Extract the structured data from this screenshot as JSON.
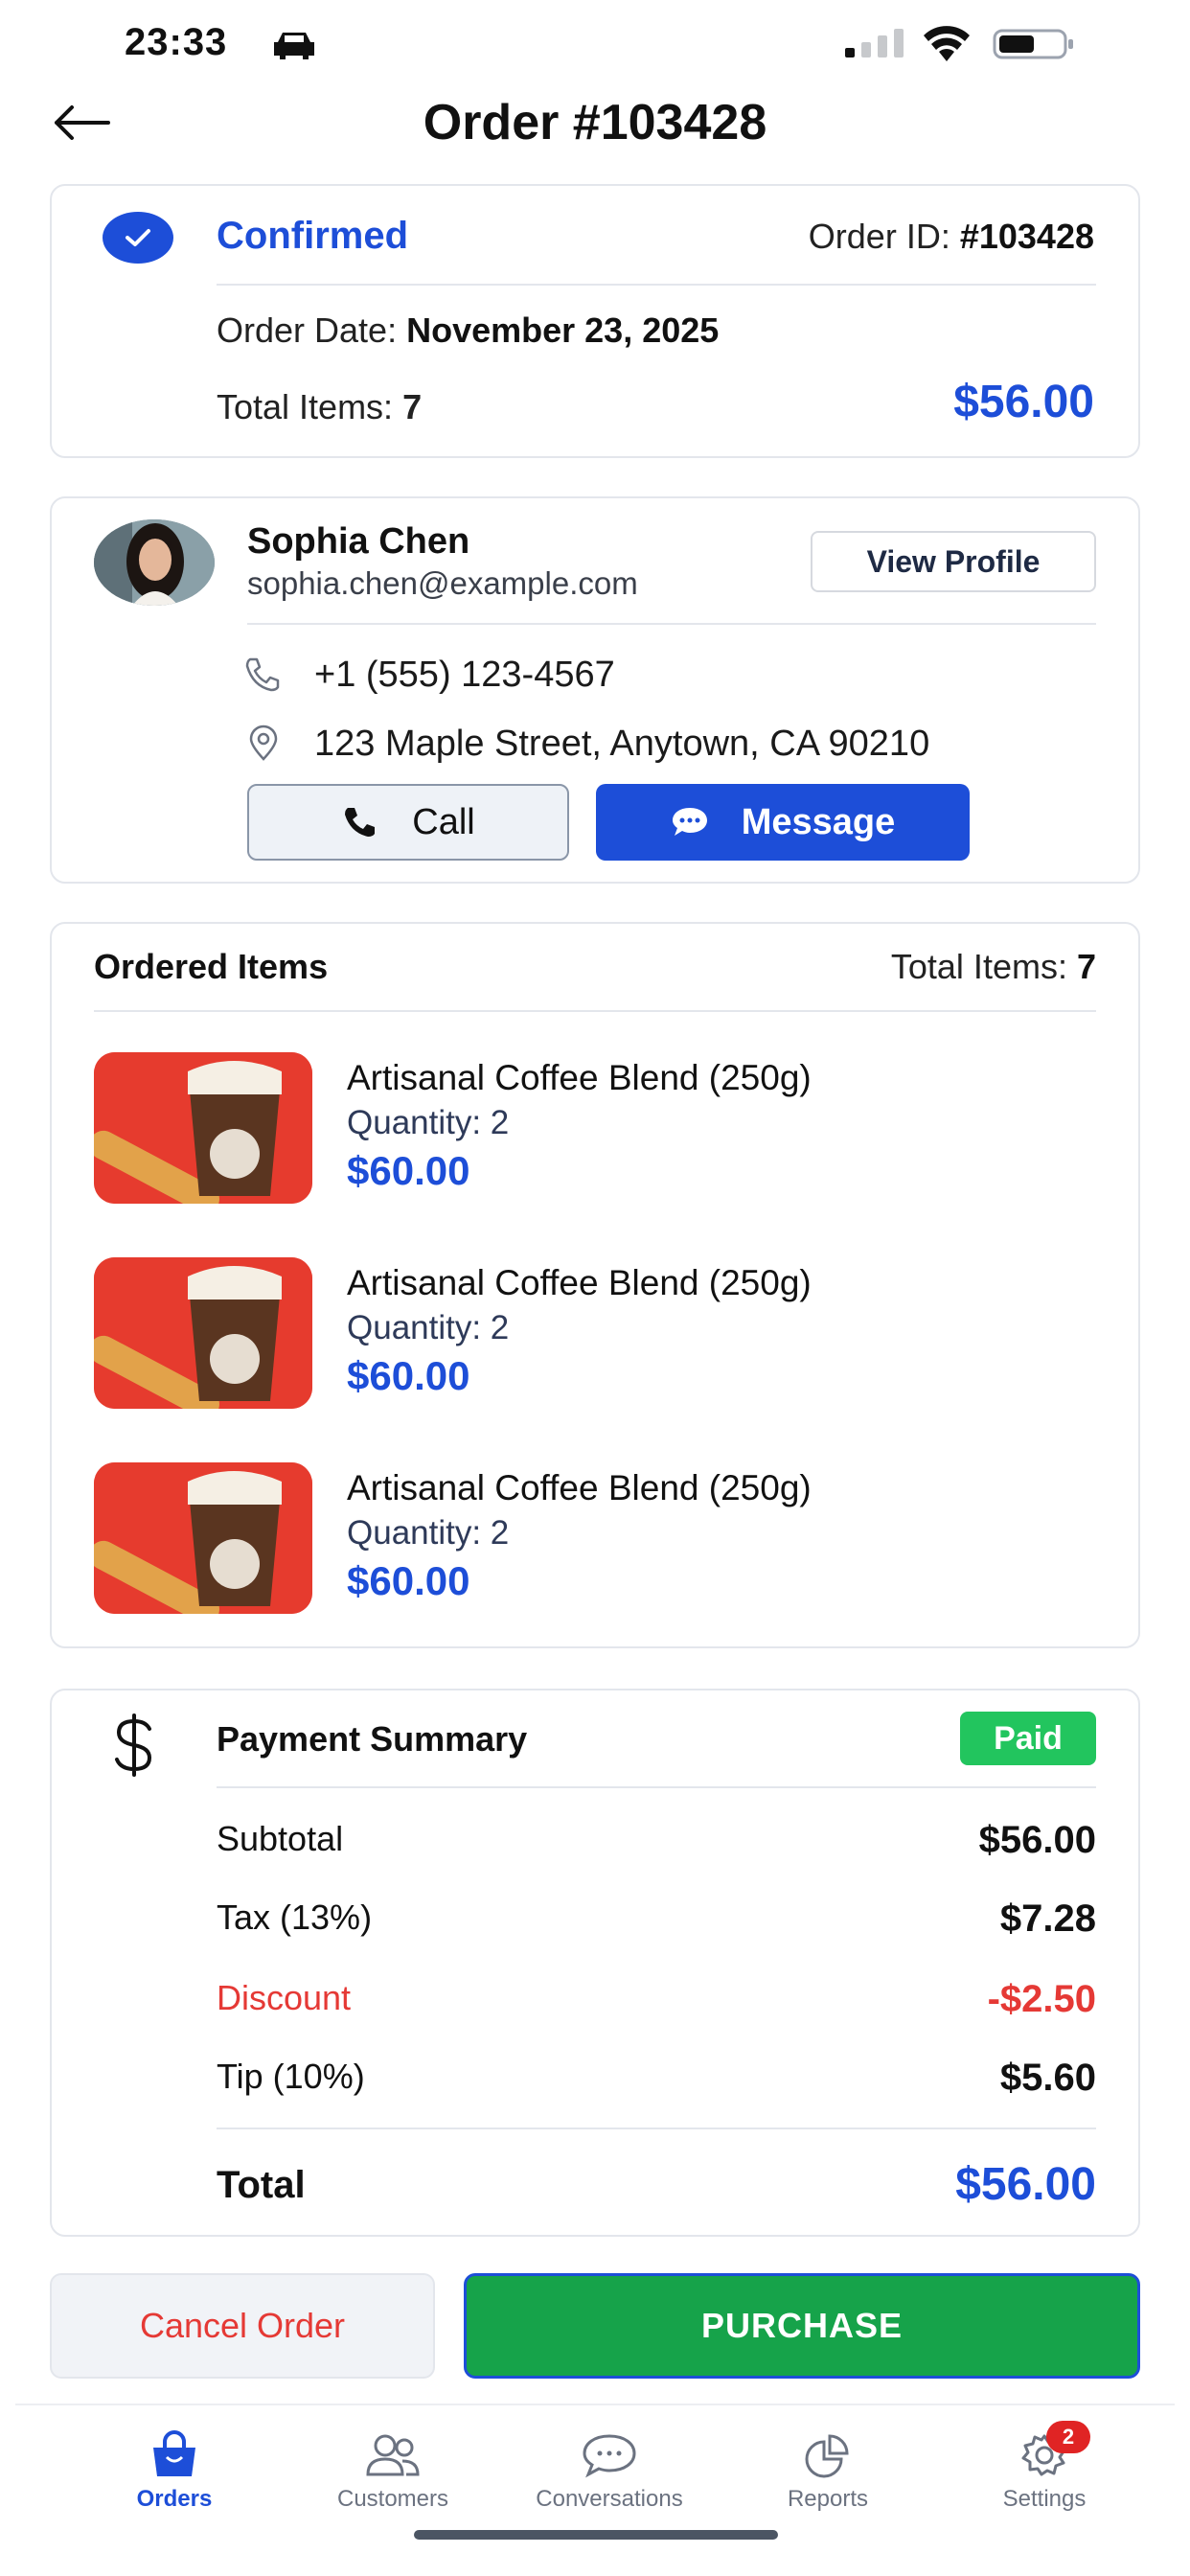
{
  "status_bar": {
    "time": "23:33"
  },
  "nav": {
    "title": "Order #103428"
  },
  "order": {
    "status": "Confirmed",
    "id_label": "Order ID:",
    "id_value": "#103428",
    "date_label": "Order Date:",
    "date_value": "November 23, 2025",
    "items_label": "Total Items:",
    "items_value": "7",
    "total": "$56.00"
  },
  "customer": {
    "name": "Sophia Chen",
    "email": "sophia.chen@example.com",
    "view_profile_label": "View Profile",
    "phone": "+1 (555) 123-4567",
    "address": "123 Maple Street, Anytown, CA 90210",
    "call_label": "Call",
    "message_label": "Message"
  },
  "items_section": {
    "title": "Ordered Items",
    "total_label": "Total Items:",
    "total_value": "7",
    "items": [
      {
        "name": "Artisanal Coffee Blend (250g)",
        "quantity": "Quantity: 2",
        "price": "$60.00"
      },
      {
        "name": "Artisanal Coffee Blend (250g)",
        "quantity": "Quantity: 2",
        "price": "$60.00"
      },
      {
        "name": "Artisanal Coffee Blend (250g)",
        "quantity": "Quantity: 2",
        "price": "$60.00"
      }
    ]
  },
  "payment": {
    "title": "Payment Summary",
    "badge": "Paid",
    "subtotal_label": "Subtotal",
    "subtotal_value": "$56.00",
    "tax_label": "Tax (13%)",
    "tax_value": "$7.28",
    "discount_label": "Discount",
    "discount_value": "-$2.50",
    "tip_label": "Tip (10%)",
    "tip_value": "$5.60",
    "total_label": "Total",
    "total_value": "$56.00"
  },
  "actions": {
    "cancel_label": "Cancel Order",
    "purchase_label": "PURCHASE"
  },
  "tabbar": {
    "tabs": [
      {
        "label": "Orders",
        "icon": "shopping-bag-icon",
        "active": true
      },
      {
        "label": "Customers",
        "icon": "users-icon"
      },
      {
        "label": "Conversations",
        "icon": "chat-icon"
      },
      {
        "label": "Reports",
        "icon": "pie-chart-icon"
      },
      {
        "label": "Settings",
        "icon": "gear-icon",
        "badge": "2"
      }
    ]
  },
  "colors": {
    "primary": "#1d4ed8",
    "success": "#22c55e",
    "purchase": "#16a34a",
    "danger": "#e53935"
  }
}
